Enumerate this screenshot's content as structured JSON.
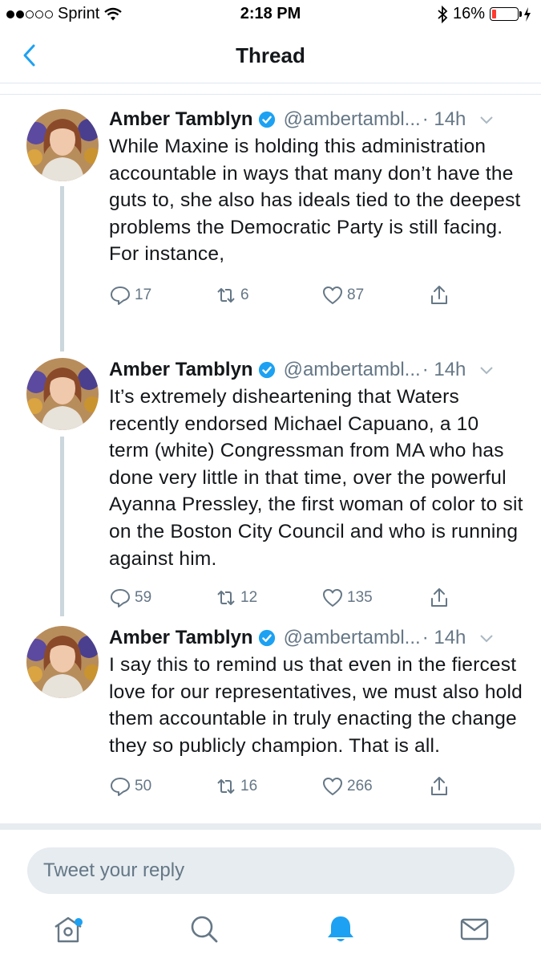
{
  "status_bar": {
    "carrier": "Sprint",
    "time": "2:18 PM",
    "battery_percent": "16%",
    "battery_level": 0.16
  },
  "nav": {
    "title": "Thread"
  },
  "tweets": [
    {
      "name": "Amber Tamblyn",
      "handle": "@ambertambl...",
      "time": "· 14h",
      "text": "While Maxine is holding this administration accountable in ways that many don’t have the guts to, she also has ideals tied to the deepest problems the Democratic Party is still facing. For instance,",
      "replies": "17",
      "retweets": "6",
      "likes": "87"
    },
    {
      "name": "Amber Tamblyn",
      "handle": "@ambertambl...",
      "time": "· 14h",
      "text": "It’s extremely disheartening that Waters recently endorsed Michael Capuano, a 10 term (white) Congressman from MA who has done very little in that time, over the powerful Ayanna Pressley, the first woman of color to sit on the Boston City Council and who is running against him.",
      "replies": "59",
      "retweets": "12",
      "likes": "135"
    },
    {
      "name": "Amber Tamblyn",
      "handle": "@ambertambl...",
      "time": "· 14h",
      "text": "I say this to remind us that even in the fiercest love for our representatives, we must also hold them accountable in truly enacting the change they so publicly champion. That is all.",
      "replies": "50",
      "retweets": "16",
      "likes": "266"
    }
  ],
  "reply": {
    "placeholder": "Tweet your reply"
  },
  "colors": {
    "accent": "#1da1f2",
    "secondary_text": "#657786",
    "battery_low": "#ff3b30"
  },
  "tab_bar": {
    "tabs": [
      "home-icon",
      "search-icon",
      "notifications-icon",
      "messages-icon"
    ],
    "active": "notifications-icon"
  }
}
